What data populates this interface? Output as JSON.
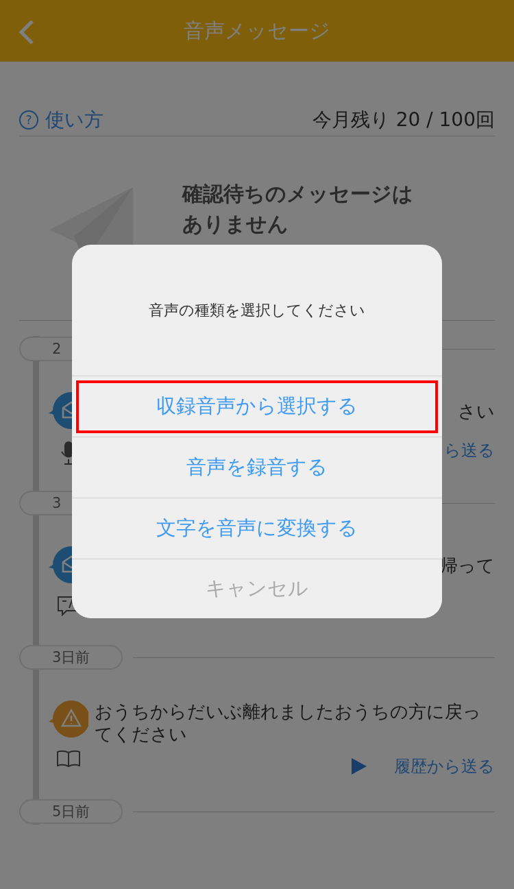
{
  "header": {
    "title": "音声メッセージ"
  },
  "usage": {
    "help_icon": "?",
    "help_link": "使い方",
    "remaining": "今月残り 20 / 100回"
  },
  "empty_state": {
    "message": "確認待ちのメッセージはありません"
  },
  "timeline": [
    {
      "date": "2",
      "messages": [
        {
          "kind": "mail",
          "media": {
            "kind": "voice"
          },
          "text": "さい",
          "action": "ら送る"
        }
      ]
    },
    {
      "date": "3",
      "messages": [
        {
          "kind": "mail",
          "media": {
            "kind": "text"
          },
          "text": "帰って"
        }
      ]
    },
    {
      "date": "3日前",
      "messages": [
        {
          "kind": "warning",
          "media": {
            "kind": "book"
          },
          "text": "おうちからだいぶ離れましたおうちの方に戻ってください",
          "action": "履歴から送る"
        }
      ]
    },
    {
      "date": "5日前"
    }
  ],
  "dialog": {
    "title": "音声の種類を選択してください",
    "options": [
      {
        "label": "収録音声から選択する",
        "kind": "action",
        "highlighted": true
      },
      {
        "label": "音声を録音する",
        "kind": "action",
        "highlighted": false
      },
      {
        "label": "文字を音声に変換する",
        "kind": "action",
        "highlighted": false
      },
      {
        "label": "キャンセル",
        "kind": "cancel",
        "highlighted": false
      }
    ]
  }
}
